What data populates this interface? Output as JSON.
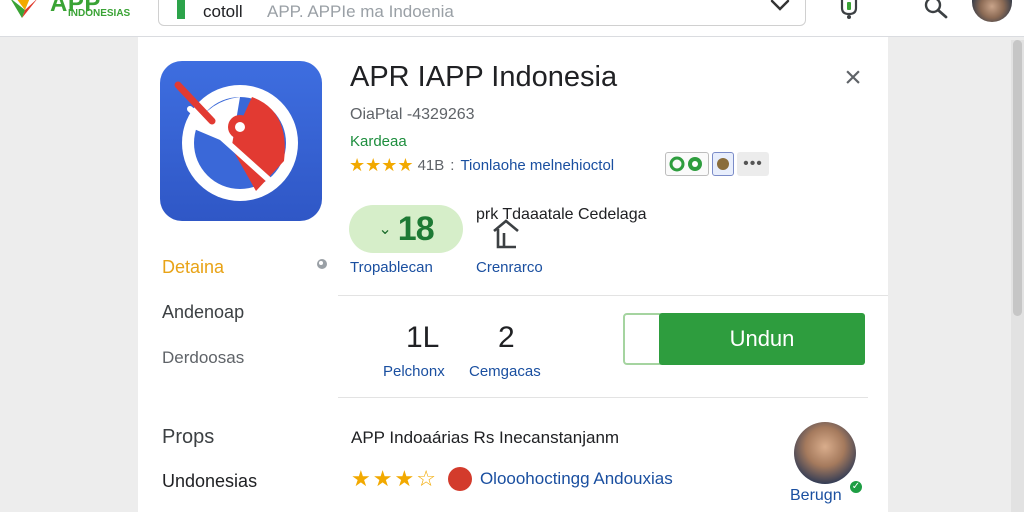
{
  "header": {
    "logo_title": "APP",
    "logo_subtitle": "INDONESIAS",
    "search_value": "cotoll",
    "search_hint": "APP. APPIe ma Indoenia",
    "icons": [
      "chevron-down-icon",
      "notification-icon",
      "search-icon"
    ]
  },
  "app": {
    "title": "APR IAPP Indonesia",
    "id_text": "OiaPtal -4329263",
    "developer": "Kardeaa",
    "stars": 4,
    "rating_value": "41B",
    "rating_separator": ":",
    "rating_link": "Tionlaohe melnehioctol",
    "more_badge": "•••",
    "close_icon": "×",
    "score": "18",
    "install_label": "prk Tdaaatale Cedelaga",
    "score_caption": "Tropablecan",
    "install_caption": "Crenrarco"
  },
  "sidebar": {
    "items": [
      {
        "label": "Detaina",
        "color": "#e8a317"
      },
      {
        "label": "Andenoap"
      },
      {
        "label": "Derdoosas"
      },
      {
        "label": "Props"
      },
      {
        "label": "Undonesias"
      }
    ]
  },
  "stats": [
    {
      "value": "1L",
      "label": "Pelchonx"
    },
    {
      "value": "2",
      "label": "Cemgacas"
    }
  ],
  "download": {
    "label": "Undun",
    "color": "#2e9d3e"
  },
  "review": {
    "title": "APP Indoaárias Rs Inecanstanjanm",
    "stars": 3.5,
    "text": "Olooohoctingg Andouxias",
    "reviewer_name": "Berugn"
  },
  "colors": {
    "accent_green": "#2e9d3e",
    "link_blue": "#1a4fa0",
    "star_yellow": "#f2a900"
  }
}
